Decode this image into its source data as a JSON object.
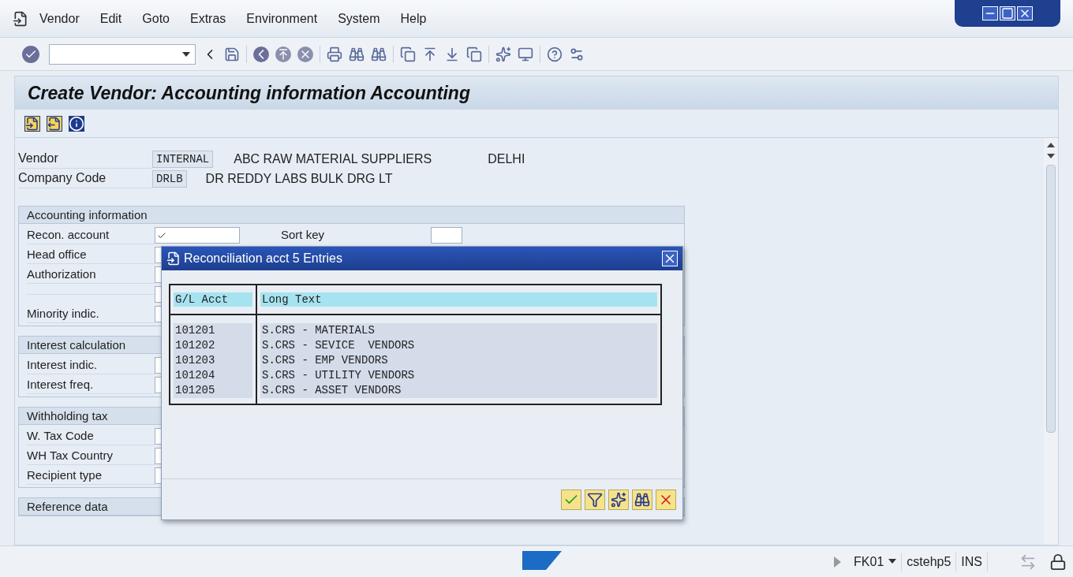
{
  "menu": [
    "Vendor",
    "Edit",
    "Goto",
    "Extras",
    "Environment",
    "System",
    "Help"
  ],
  "screen_title": "Create Vendor: Accounting information Accounting",
  "header": [
    {
      "label": "Vendor",
      "value": "INTERNAL",
      "text": "ABC RAW MATERIAL SUPPLIERS",
      "extra": "DELHI"
    },
    {
      "label": "Company Code",
      "value": "DRLB",
      "text": "DR REDDY LABS BULK DRG LT"
    }
  ],
  "sections": [
    {
      "title": "Accounting information",
      "rows": [
        {
          "label": "Recon. account",
          "side_label": "Sort key"
        },
        {
          "label": "Head office"
        },
        {
          "label": "Authorization"
        },
        {
          "label": ""
        },
        {
          "label": "Minority indic."
        }
      ]
    },
    {
      "title": "Interest calculation",
      "rows": [
        {
          "label": "Interest indic."
        },
        {
          "label": "Interest freq."
        }
      ]
    },
    {
      "title": "Withholding tax",
      "rows": [
        {
          "label": "W. Tax Code"
        },
        {
          "label": "WH Tax Country"
        },
        {
          "label": "Recipient type"
        }
      ]
    },
    {
      "title": "Reference data"
    }
  ],
  "dialog": {
    "title": "Reconciliation acct 5 Entries",
    "columns": [
      "G/L Acct",
      "Long Text"
    ],
    "rows": [
      [
        "101201",
        "S.CRS - MATERIALS"
      ],
      [
        "101202",
        "S.CRS - SEVICE  VENDORS"
      ],
      [
        "101203",
        "S.CRS - EMP VENDORS"
      ],
      [
        "101204",
        "S.CRS - UTILITY VENDORS"
      ],
      [
        "101205",
        "S.CRS - ASSET VENDORS"
      ]
    ]
  },
  "status_bar": {
    "transaction": "FK01",
    "server": "cstehp5",
    "mode": "INS"
  }
}
